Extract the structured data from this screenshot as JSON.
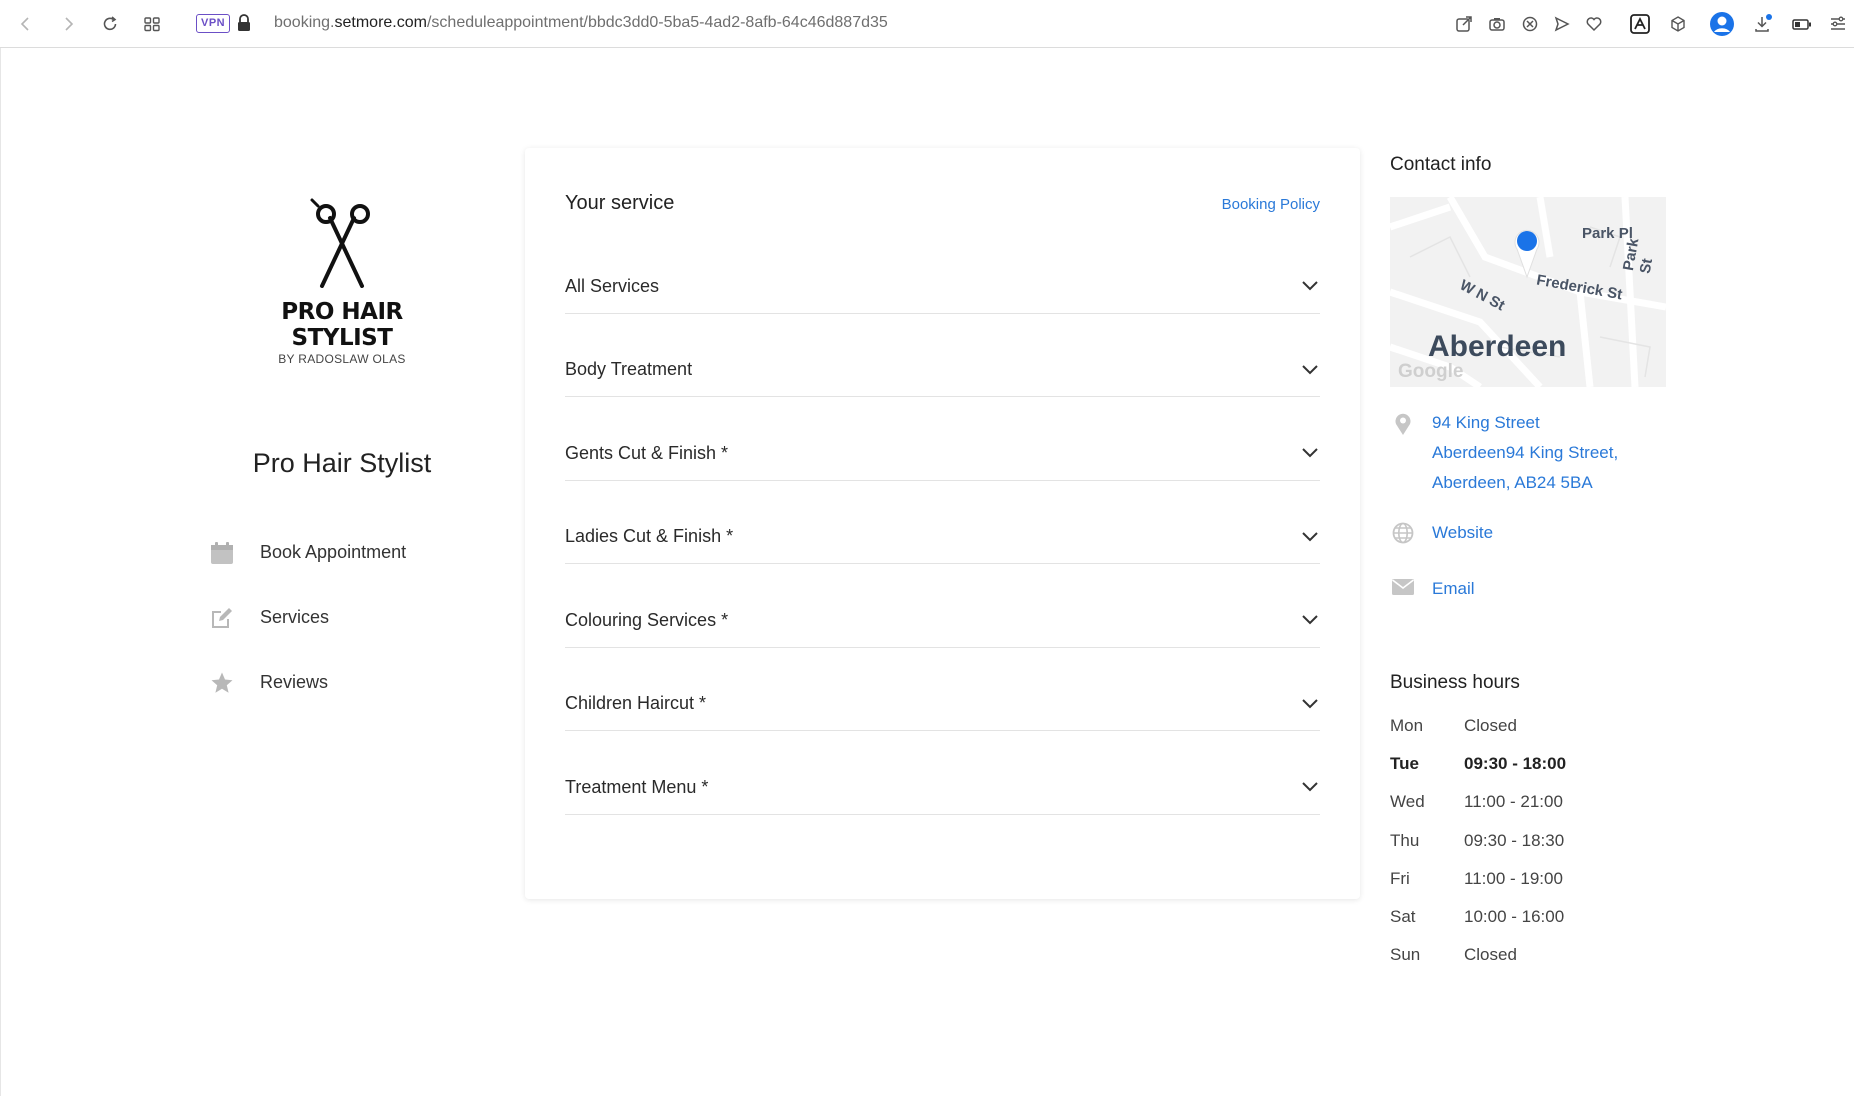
{
  "browser": {
    "url_prefix": "booking.",
    "url_domain": "setmore.com",
    "url_path": "/scheduleappointment/bbdc3dd0-5ba5-4ad2-8afb-64c46d887d35",
    "vpn_label": "VPN"
  },
  "business": {
    "logo_text": "PRO HAIR STYLIST",
    "logo_subtext": "BY RADOSLAW OLAS",
    "name": "Pro Hair Stylist"
  },
  "sidebar": {
    "items": [
      {
        "label": "Book Appointment",
        "icon": "calendar-icon"
      },
      {
        "label": "Services",
        "icon": "edit-icon"
      },
      {
        "label": "Reviews",
        "icon": "star-icon"
      }
    ]
  },
  "services": {
    "title": "Your service",
    "booking_policy": "Booking Policy",
    "categories": [
      "All Services",
      "Body Treatment",
      "Gents Cut & Finish *",
      "Ladies Cut & Finish *",
      "Colouring Services *",
      "Children Haircut *",
      "Treatment Menu *"
    ]
  },
  "contact": {
    "title": "Contact info",
    "map": {
      "city": "Aberdeen",
      "google": "Google",
      "streets": [
        "Park Pl",
        "Frederick St",
        "W N St",
        "Park St"
      ]
    },
    "address_line1": "94 King Street",
    "address_line2": "Aberdeen94 King Street,",
    "address_line3": "Aberdeen, AB24 5BA",
    "website": "Website",
    "email": "Email"
  },
  "hours": {
    "title": "Business hours",
    "days": [
      {
        "day": "Mon",
        "time": "Closed"
      },
      {
        "day": "Tue",
        "time": "09:30 - 18:00",
        "today": true
      },
      {
        "day": "Wed",
        "time": "11:00 - 21:00"
      },
      {
        "day": "Thu",
        "time": "09:30 - 18:30"
      },
      {
        "day": "Fri",
        "time": "11:00 - 19:00"
      },
      {
        "day": "Sat",
        "time": "10:00 - 16:00"
      },
      {
        "day": "Sun",
        "time": "Closed"
      }
    ]
  },
  "colors": {
    "link": "#2a79d8",
    "pin": "#1a73e8",
    "vpn": "#6b4fc6"
  }
}
